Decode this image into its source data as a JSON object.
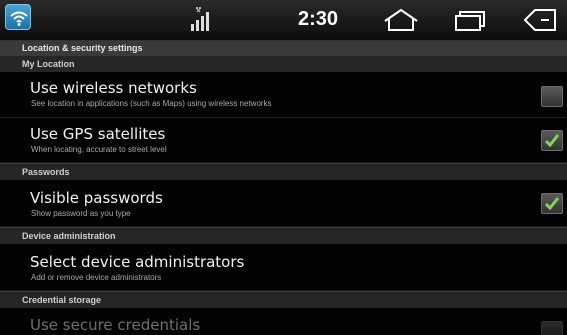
{
  "status_bar": {
    "time": "2:30",
    "icons": [
      "wifi-icon",
      "signal-icon",
      "home-icon",
      "recent-apps-icon",
      "back-icon"
    ]
  },
  "screen": {
    "title": "Location & security settings"
  },
  "sections": {
    "my_location": "My Location",
    "passwords": "Passwords",
    "device_admin": "Device administration",
    "credential_storage": "Credential storage"
  },
  "prefs": {
    "wireless": {
      "title": "Use wireless networks",
      "summary": "See location in applications (such as Maps) using wireless networks",
      "checked": false
    },
    "gps": {
      "title": "Use GPS satellites",
      "summary": "When locating, accurate to street level",
      "checked": true
    },
    "visible_passwords": {
      "title": "Visible passwords",
      "summary": "Show password as you type",
      "checked": true
    },
    "device_admins": {
      "title": "Select device administrators",
      "summary": "Add or remove device administrators"
    },
    "secure_credentials": {
      "title": "Use secure credentials",
      "checked": false,
      "enabled": false
    }
  },
  "colors": {
    "check_green": "#8bd15a",
    "wifi_badge": "#2e8cc4"
  }
}
